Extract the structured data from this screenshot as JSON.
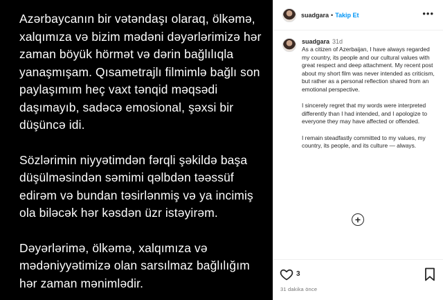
{
  "post": {
    "paragraphs": [
      "Azərbaycanın bir vətəndaşı olaraq, ölkəmə, xalqımıza və bizim mədəni dəyərlərimizə hər zaman böyük hörmət və dərin bağlılıqla yanaşmışam. Qısametrajlı filmimlə bağlı son paylaşımım heç vaxt tənqid məqsədi daşımayıb, sadəcə emosional, şəxsi bir düşüncə idi.",
      "Sözlərimin niyyətimdən fərqli şəkildə başa düşülməsindən səmimi qəlbdən təəssüf edirəm və bundan təsirlənmiş və ya incimiş ola biləcək hər kəsdən üzr istəyirəm.",
      "Dəyərlərimə, ölkəmə, xalqımıza və mədəniyyətimizə olan sarsılmaz bağlılığım hər zaman mənimlədir."
    ]
  },
  "header": {
    "username": "suadgara",
    "separator": "•",
    "follow_label": "Takip Et",
    "more_label": "•••"
  },
  "caption": {
    "username": "suadgara",
    "time_ago": "31d",
    "paragraphs": [
      "As a citizen of Azerbaijan, I have always regarded my country, its people and our cultural values with great respect and deep attachment. My recent post about my short film was never intended as criticism, but rather as a personal reflection shared from an emotional perspective.",
      "I sincerely regret that my words were interpreted differently than I had intended, and I apologize to everyone they may have affected or offended.",
      "I remain steadfastly committed to my values, my country, its people, and its culture — always."
    ]
  },
  "add_comment": {
    "symbol": "+"
  },
  "actions": {
    "like_count": "3",
    "timestamp": "31 dakika önce"
  },
  "icons": {
    "like": "heart-icon",
    "bookmark": "bookmark-icon",
    "add": "plus-circle-icon",
    "more": "more-icon"
  }
}
